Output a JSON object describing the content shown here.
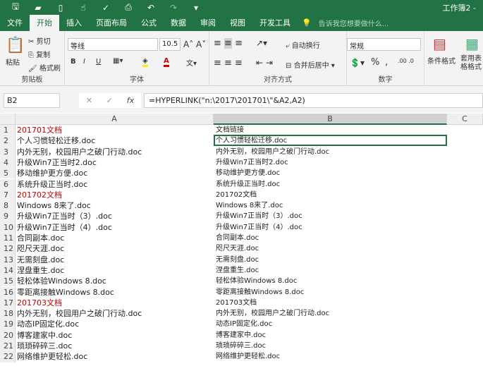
{
  "title": "工作簿2 -",
  "qat": [
    "save-icon",
    "open-icon",
    "new-icon",
    "touch-icon",
    "spell-icon",
    "preview-icon",
    "undo-icon",
    "redo-icon",
    "customize-icon"
  ],
  "tabs": [
    "文件",
    "开始",
    "插入",
    "页面布局",
    "公式",
    "数据",
    "审阅",
    "视图",
    "开发工具"
  ],
  "tell_me": "告诉我您想要做什么...",
  "ribbon": {
    "clipboard": {
      "paste": "粘贴",
      "cut": "剪切",
      "copy": "复制",
      "painter": "格式刷",
      "label": "剪贴板"
    },
    "font": {
      "name": "等线",
      "size": "10.5",
      "label": "字体",
      "bold": "B",
      "italic": "I",
      "underline": "U"
    },
    "align": {
      "wrap": "自动换行",
      "merge": "合并后居中",
      "label": "对齐方式"
    },
    "number": {
      "format": "常规",
      "percent": "%",
      "comma": ",",
      "label": "数字"
    },
    "styles": {
      "cond": "条件格式",
      "table": "套用表格格式"
    }
  },
  "namebox": "B2",
  "formula": "=HYPERLINK(\"n:\\2017\\201701\\\"&A2,A2)",
  "columns": [
    "A",
    "B",
    "C"
  ],
  "rows": [
    {
      "n": "1",
      "a": "201701文档",
      "b": "文档链接",
      "red": true
    },
    {
      "n": "2",
      "a": "个人习惯轻松迁移.doc",
      "b": "个人习惯轻松迁移.doc"
    },
    {
      "n": "3",
      "a": "内外无别，校园用户之破门行动.doc",
      "b": "内外无别，校园用户之破门行动.doc"
    },
    {
      "n": "4",
      "a": "升级Win7正当时2.doc",
      "b": "升级Win7正当时2.doc"
    },
    {
      "n": "5",
      "a": "移动维护更方便.doc",
      "b": "移动维护更方便.doc"
    },
    {
      "n": "6",
      "a": "系统升级正当时.doc",
      "b": "系统升级正当时.doc"
    },
    {
      "n": "7",
      "a": "201702文档",
      "b": "201702文档",
      "red": true
    },
    {
      "n": "8",
      "a": "Windows 8来了.doc",
      "b": "Windows 8来了.doc"
    },
    {
      "n": "9",
      "a": "升级Win7正当时（3）.doc",
      "b": "升级Win7正当时（3）.doc"
    },
    {
      "n": "10",
      "a": "升级Win7正当时（4）.doc",
      "b": "升级Win7正当时（4）.doc"
    },
    {
      "n": "11",
      "a": "合同副本.doc",
      "b": "合同副本.doc"
    },
    {
      "n": "12",
      "a": "咫尺天涯.doc",
      "b": "咫尺天涯.doc"
    },
    {
      "n": "13",
      "a": "无需刻盘.doc",
      "b": "无需刻盘.doc"
    },
    {
      "n": "14",
      "a": "涅盘重生.doc",
      "b": "涅盘重生.doc"
    },
    {
      "n": "15",
      "a": "轻松体验Windows 8.doc",
      "b": "轻松体验Windows 8.doc"
    },
    {
      "n": "16",
      "a": "零距离接触Windows 8.doc",
      "b": "零距离接触Windows 8.doc"
    },
    {
      "n": "17",
      "a": "201703文档",
      "b": "201703文档",
      "red": true
    },
    {
      "n": "18",
      "a": "内外无别，校园用户之破门行动.doc",
      "b": "内外无别，校园用户之破门行动.doc"
    },
    {
      "n": "19",
      "a": "动态IP固定化.doc",
      "b": "动态IP固定化.doc"
    },
    {
      "n": "20",
      "a": "博客建家中.doc",
      "b": "博客建家中.doc"
    },
    {
      "n": "21",
      "a": "琐琐碎碎三.doc",
      "b": "琐琐碎碎三.doc"
    },
    {
      "n": "22",
      "a": "网络维护更轻松.doc",
      "b": "网络维护更轻松.doc"
    }
  ]
}
